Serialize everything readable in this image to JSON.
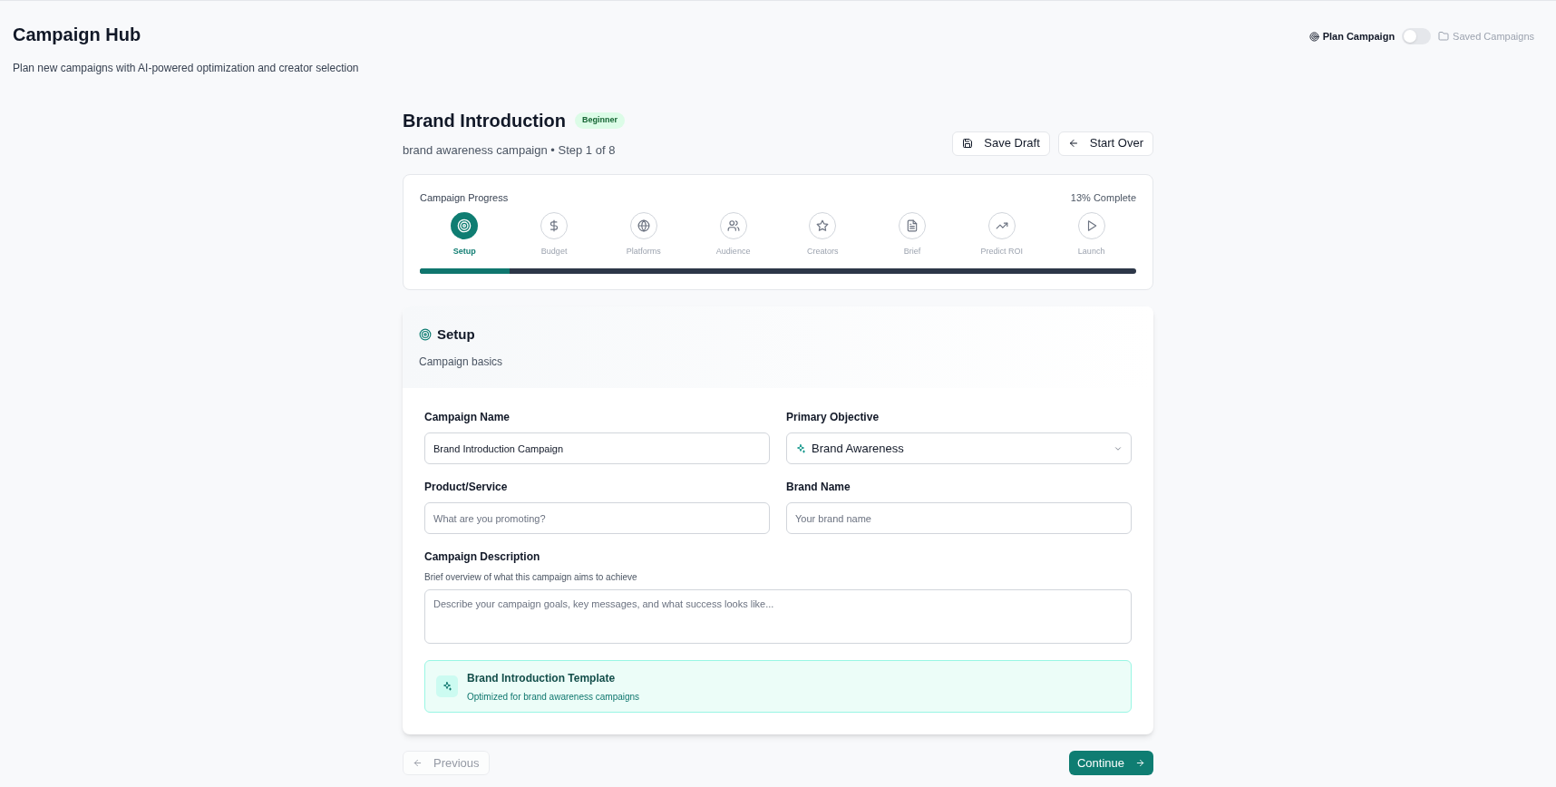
{
  "header": {
    "title": "Campaign Hub",
    "subtitle": "Plan new campaigns with AI-powered optimization and creator selection",
    "mode_label": "Plan Campaign",
    "toggle": {
      "on": false
    },
    "saved_link": "Saved Campaigns"
  },
  "campaign": {
    "title": "Brand Introduction",
    "badge": "Beginner",
    "subtitle": "brand awareness campaign • Step 1 of 8",
    "buttons": [
      "Save Draft",
      "Start Over"
    ]
  },
  "progress": {
    "title": "Campaign Progress",
    "percent_text": "13% Complete",
    "level": 0.125,
    "steps": [
      {
        "label": "Setup",
        "selected": true
      },
      {
        "label": "Budget",
        "selected": false
      },
      {
        "label": "Platforms",
        "selected": false
      },
      {
        "label": "Audience",
        "selected": false
      },
      {
        "label": "Creators",
        "selected": false
      },
      {
        "label": "Brief",
        "selected": false
      },
      {
        "label": "Predict ROI",
        "selected": false
      },
      {
        "label": "Launch",
        "selected": false
      }
    ]
  },
  "section": {
    "title": "Setup",
    "subtitle": "Campaign basics"
  },
  "fields": [
    {
      "kind": "input",
      "label": "Campaign Name",
      "value": "Brand Introduction Campaign"
    },
    {
      "kind": "select",
      "label": "Primary Objective",
      "value": "Brand Awareness"
    },
    {
      "kind": "input",
      "label": "Product/Service",
      "placeholder": "What are you promoting?"
    },
    {
      "kind": "input",
      "label": "Brand Name",
      "placeholder": "Your brand name"
    }
  ],
  "description": {
    "label": "Campaign Description",
    "hint": "Brief overview of what this campaign aims to achieve",
    "placeholder": "Describe your campaign goals, key messages, and what success looks like..."
  },
  "template": {
    "title": "Brand Introduction Template",
    "subtitle": "Optimized for brand awareness campaigns"
  },
  "footer": {
    "previous": {
      "label": "Previous",
      "disabled": true
    },
    "continue": {
      "label": "Continue"
    }
  }
}
